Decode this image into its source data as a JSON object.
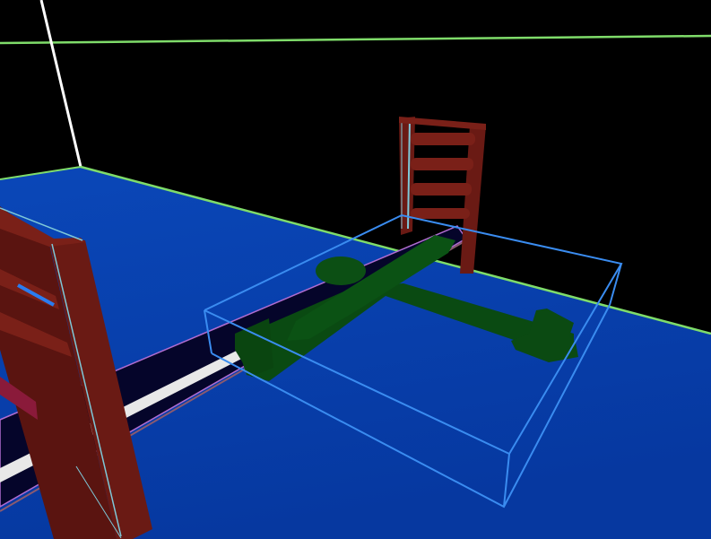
{
  "scene": {
    "type": "3d-viewport",
    "objects": [
      "floor",
      "wall-edges",
      "ladder-near",
      "ladder-far",
      "rail-track",
      "selection-box",
      "airplane"
    ]
  },
  "colors": {
    "background": "#000000",
    "floor": "#0841b0",
    "floor_edge": "#7fdc6a",
    "wall_edge": "#ffffff",
    "ladder": "#6a1a14",
    "ladder_highlight": "#7ec8d8",
    "track": "#05052a",
    "track_stripe": "#e8e8e8",
    "selection_box": "#3a8cf0",
    "airplane": "#0a4a12"
  }
}
